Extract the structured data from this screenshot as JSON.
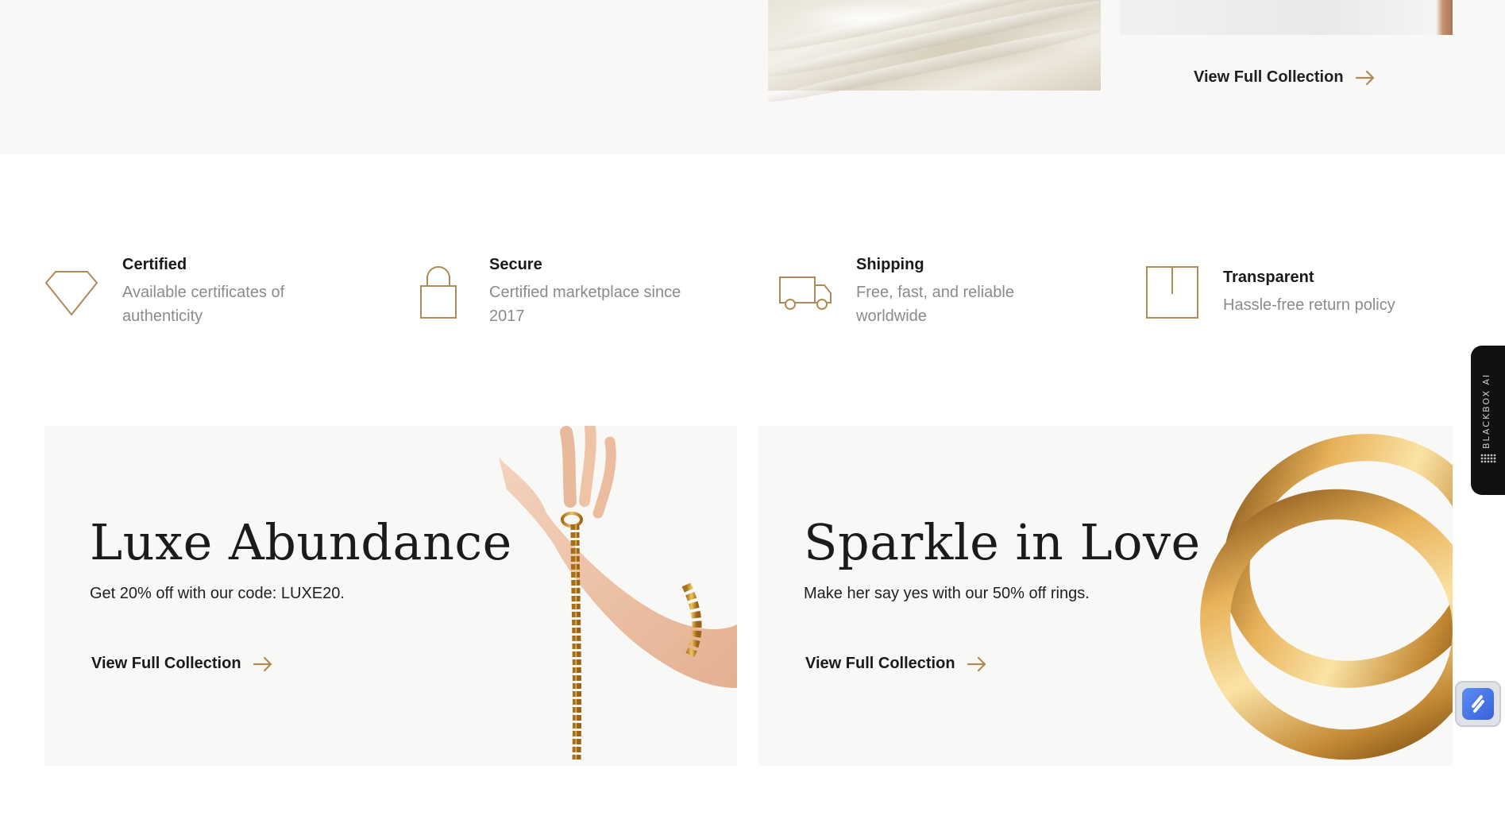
{
  "top": {
    "cta_label": "View Full Collection"
  },
  "features": [
    {
      "icon": "diamond-icon",
      "title": "Certified",
      "desc_line1": "Available certificates of",
      "desc_line2": "authenticity"
    },
    {
      "icon": "lock-icon",
      "title": "Secure",
      "desc_line1": "Certified marketplace since",
      "desc_line2": "2017"
    },
    {
      "icon": "truck-icon",
      "title": "Shipping",
      "desc_line1": "Free, fast, and reliable",
      "desc_line2": "worldwide"
    },
    {
      "icon": "box-icon",
      "title": "Transparent",
      "desc_line1": "Hassle-free return policy",
      "desc_line2": ""
    }
  ],
  "promos": [
    {
      "heading": "Luxe Abundance",
      "subtext": "Get 20% off with our code: LUXE20.",
      "cta_label": "View Full Collection"
    },
    {
      "heading": "Sparkle in Love",
      "subtext": "Make her say yes with our 50% off rings.",
      "cta_label": "View Full Collection"
    }
  ],
  "widgets": {
    "ai_tab_label": "BLACKBOX AI"
  },
  "colors": {
    "accent": "#b08a56",
    "band_bg": "#f9f8f6",
    "card_bg": "#f8f8f7",
    "text_muted": "#8b8b8b"
  }
}
